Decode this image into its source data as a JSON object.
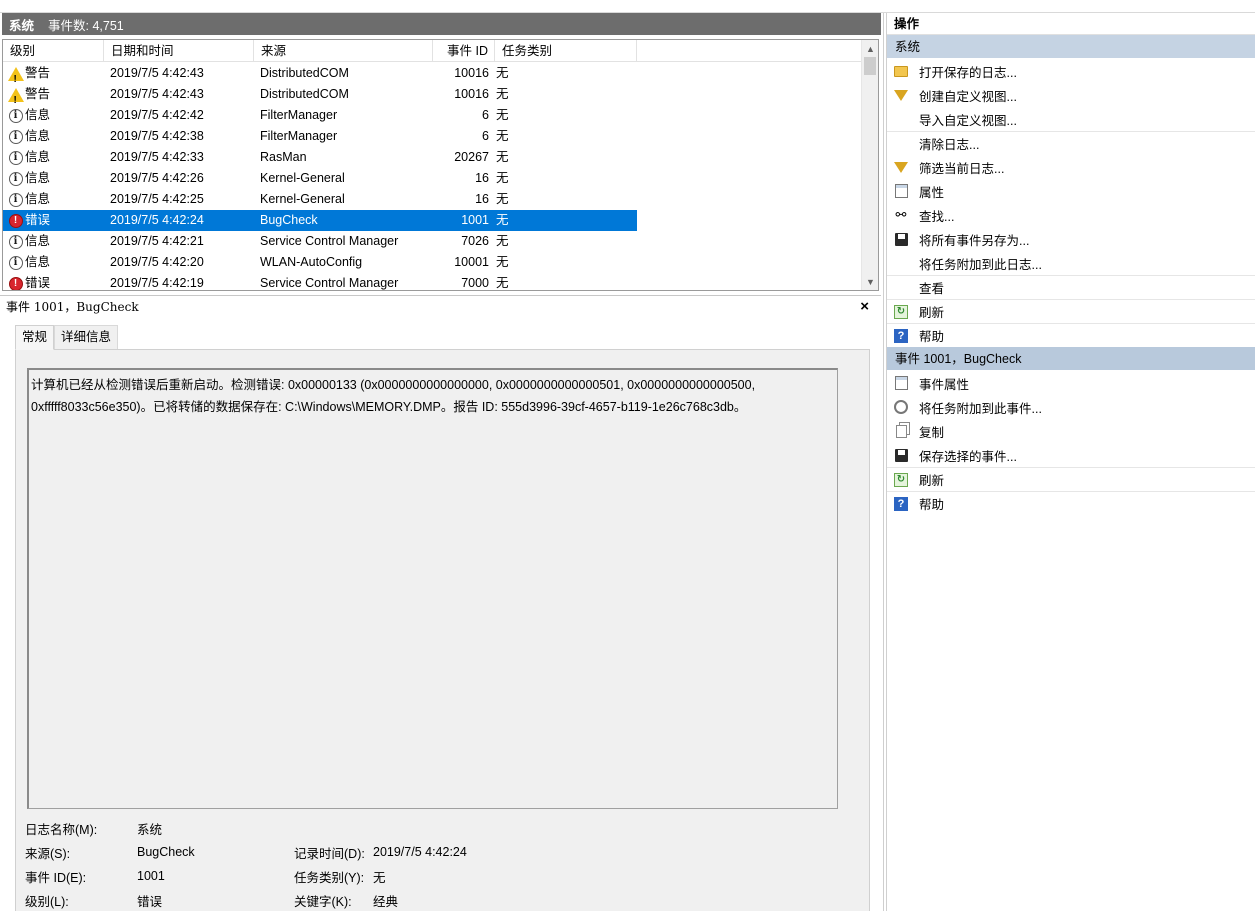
{
  "log_header": {
    "name": "系统",
    "count_label": "事件数: 4,751"
  },
  "columns": [
    "级别",
    "日期和时间",
    "来源",
    "事件 ID",
    "任务类别"
  ],
  "events": [
    {
      "level": "警告",
      "icon": "warning-icon",
      "datetime": "2019/7/5 4:42:43",
      "source": "DistributedCOM",
      "event_id": "10016",
      "task": "无"
    },
    {
      "level": "警告",
      "icon": "warning-icon",
      "datetime": "2019/7/5 4:42:43",
      "source": "DistributedCOM",
      "event_id": "10016",
      "task": "无"
    },
    {
      "level": "信息",
      "icon": "info-icon",
      "datetime": "2019/7/5 4:42:42",
      "source": "FilterManager",
      "event_id": "6",
      "task": "无"
    },
    {
      "level": "信息",
      "icon": "info-icon",
      "datetime": "2019/7/5 4:42:38",
      "source": "FilterManager",
      "event_id": "6",
      "task": "无"
    },
    {
      "level": "信息",
      "icon": "info-icon",
      "datetime": "2019/7/5 4:42:33",
      "source": "RasMan",
      "event_id": "20267",
      "task": "无"
    },
    {
      "level": "信息",
      "icon": "info-icon",
      "datetime": "2019/7/5 4:42:26",
      "source": "Kernel-General",
      "event_id": "16",
      "task": "无"
    },
    {
      "level": "信息",
      "icon": "info-icon",
      "datetime": "2019/7/5 4:42:25",
      "source": "Kernel-General",
      "event_id": "16",
      "task": "无"
    },
    {
      "level": "错误",
      "icon": "error-icon",
      "datetime": "2019/7/5 4:42:24",
      "source": "BugCheck",
      "event_id": "1001",
      "task": "无",
      "selected": true
    },
    {
      "level": "信息",
      "icon": "info-icon",
      "datetime": "2019/7/5 4:42:21",
      "source": "Service Control Manager",
      "event_id": "7026",
      "task": "无"
    },
    {
      "level": "信息",
      "icon": "info-icon",
      "datetime": "2019/7/5 4:42:20",
      "source": "WLAN-AutoConfig",
      "event_id": "10001",
      "task": "无"
    },
    {
      "level": "错误",
      "icon": "error-icon",
      "datetime": "2019/7/5 4:42:19",
      "source": "Service Control Manager",
      "event_id": "7000",
      "task": "无"
    }
  ],
  "detail": {
    "title": "事件 1001，BugCheck",
    "close_glyph": "×",
    "tabs": [
      "常规",
      "详细信息"
    ],
    "description_line1": "计算机已经从检测错误后重新启动。检测错误: 0x00000133 (0x0000000000000000, 0x0000000000000501, 0x0000000000000500,",
    "description_line2": "0xfffff8033c56e350)。已将转储的数据保存在: C:\\Windows\\MEMORY.DMP。报告 ID: 555d3996-39cf-4657-b119-1e26c768c3db。",
    "props": {
      "log_name_label": "日志名称(M):",
      "log_name_value": "系统",
      "source_label": "来源(S):",
      "source_value": "BugCheck",
      "logged_label": "记录时间(D):",
      "logged_value": "2019/7/5 4:42:24",
      "event_id_label": "事件 ID(E):",
      "event_id_value": "1001",
      "task_label": "任务类别(Y):",
      "task_value": "无",
      "level_label": "级别(L):",
      "level_value": "错误",
      "keywords_label": "关键字(K):",
      "keywords_value": "经典"
    }
  },
  "actions": {
    "header": "操作",
    "system_section": {
      "title": "系统",
      "items": [
        {
          "label": "打开保存的日志...",
          "icon": "folder-open-icon"
        },
        {
          "label": "创建自定义视图...",
          "icon": "filter-icon"
        },
        {
          "label": "导入自定义视图...",
          "icon": ""
        },
        {
          "label": "清除日志...",
          "icon": ""
        },
        {
          "label": "筛选当前日志...",
          "icon": "filter-icon"
        },
        {
          "label": "属性",
          "icon": "properties-icon"
        },
        {
          "label": "查找...",
          "icon": "binoculars-icon"
        },
        {
          "label": "将所有事件另存为...",
          "icon": "save-icon"
        },
        {
          "label": "将任务附加到此日志...",
          "icon": ""
        },
        {
          "label": "查看",
          "icon": ""
        },
        {
          "label": "刷新",
          "icon": "refresh-icon"
        },
        {
          "label": "帮助",
          "icon": "help-icon"
        }
      ]
    },
    "event_section": {
      "title": "事件 1001，BugCheck",
      "items": [
        {
          "label": "事件属性",
          "icon": "properties-icon"
        },
        {
          "label": "将任务附加到此事件...",
          "icon": "task-clock-icon"
        },
        {
          "label": "复制",
          "icon": "copy-icon"
        },
        {
          "label": "保存选择的事件...",
          "icon": "save-icon"
        },
        {
          "label": "刷新",
          "icon": "refresh-icon"
        },
        {
          "label": "帮助",
          "icon": "help-icon"
        }
      ]
    }
  },
  "colors": {
    "selection": "#0078d7",
    "header_bar": "#6d6d6d",
    "section_header": "#c5d3e3"
  }
}
